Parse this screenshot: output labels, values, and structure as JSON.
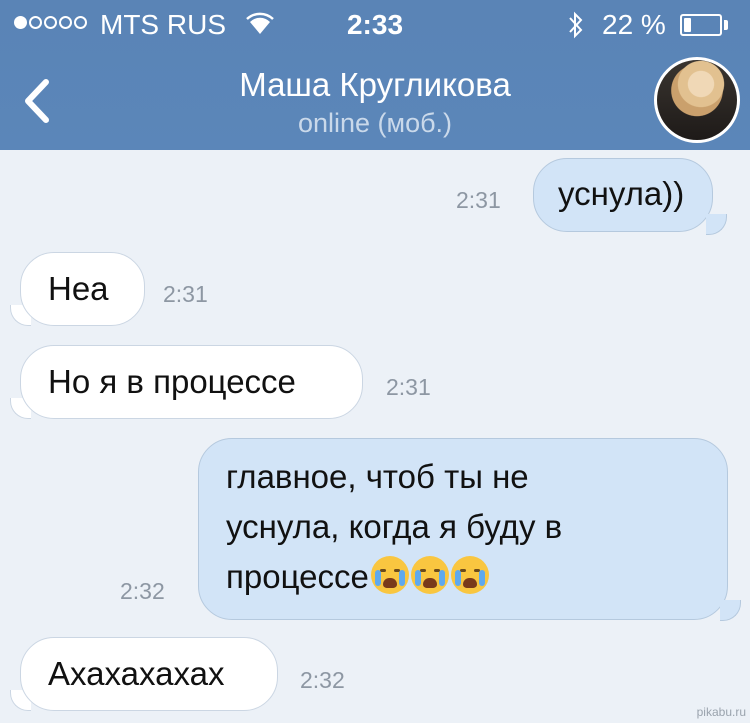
{
  "status_bar": {
    "carrier": "MTS RUS",
    "time": "2:33",
    "battery_text": "22 %",
    "battery_level": 0.22,
    "signal_bars_filled": 1,
    "signal_bars_total": 5
  },
  "header": {
    "contact_name": "Маша Кругликова",
    "presence": "online (моб.)",
    "back_icon": "chevron-left-icon",
    "avatar_icon": "contact-photo"
  },
  "messages": [
    {
      "dir": "out",
      "text": "уснула))",
      "time": "2:31"
    },
    {
      "dir": "in",
      "text": "Неа",
      "time": "2:31"
    },
    {
      "dir": "in",
      "text": "Но я в процессе",
      "time": "2:31"
    },
    {
      "dir": "out",
      "lines": [
        "главное, чтоб ты не",
        "уснула, когда я буду в",
        "процессе"
      ],
      "emoji": "crying-face-emoji",
      "emoji_count": 3,
      "time": "2:32"
    },
    {
      "dir": "in",
      "text": "Ахахахахах",
      "time": "2:32"
    }
  ],
  "watermark": "pikabu.ru",
  "colors": {
    "header": "#5a84b6",
    "background": "#ecf1f7",
    "outgoing_bubble": "#d2e4f7",
    "incoming_bubble": "#ffffff"
  }
}
